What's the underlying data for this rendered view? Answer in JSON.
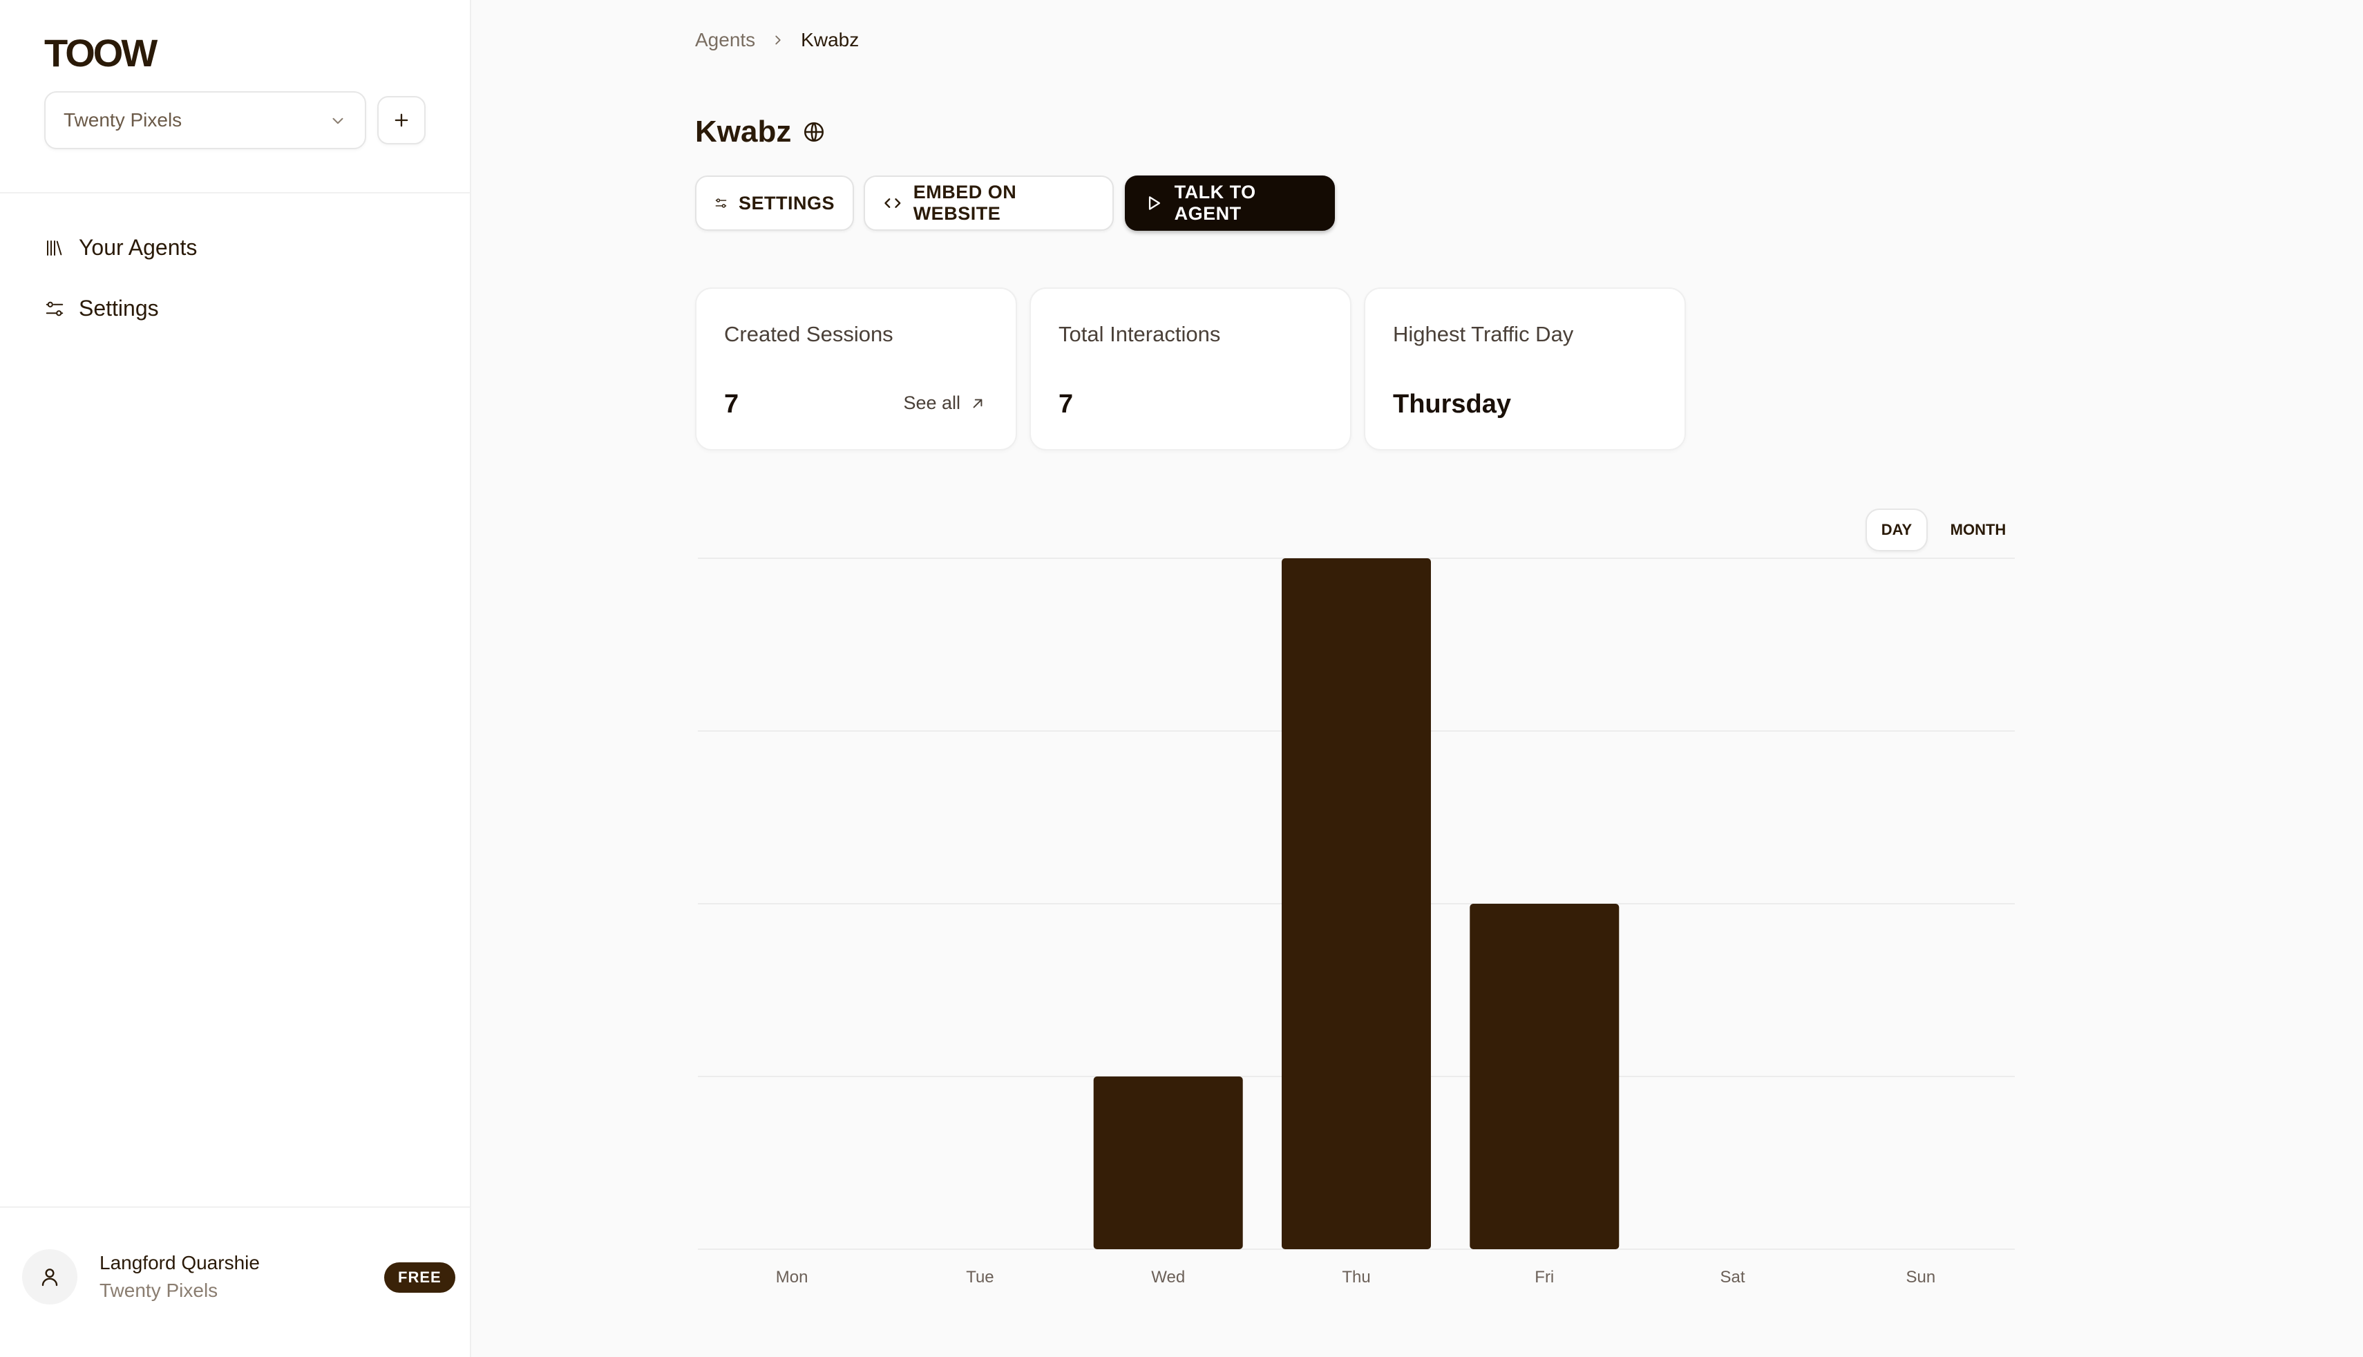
{
  "sidebar": {
    "logo": "TOOW",
    "workspace": {
      "selected": "Twenty Pixels"
    },
    "nav": [
      {
        "label": "Your Agents",
        "icon": "library-icon"
      },
      {
        "label": "Settings",
        "icon": "sliders-icon"
      }
    ],
    "user": {
      "name": "Langford Quarshie",
      "org": "Twenty Pixels",
      "plan": "FREE"
    }
  },
  "breadcrumb": {
    "parent": "Agents",
    "current": "Kwabz"
  },
  "agent": {
    "name": "Kwabz",
    "icon": "globe-icon"
  },
  "actions": {
    "settings": "SETTINGS",
    "embed": "EMBED ON WEBSITE",
    "talk": "TALK TO AGENT"
  },
  "stats": {
    "created_sessions": {
      "label": "Created Sessions",
      "value": "7",
      "link": "See all"
    },
    "total_interactions": {
      "label": "Total Interactions",
      "value": "7"
    },
    "highest_traffic_day": {
      "label": "Highest Traffic Day",
      "value": "Thursday"
    }
  },
  "toggle": {
    "day": "DAY",
    "month": "MONTH",
    "active": "DAY"
  },
  "colors": {
    "accent": "#351e07",
    "badge": "#3a2208",
    "primary_button": "#140b03"
  },
  "chart_data": {
    "type": "bar",
    "categories": [
      "Mon",
      "Tue",
      "Wed",
      "Thu",
      "Fri",
      "Sat",
      "Sun"
    ],
    "values": [
      0,
      0,
      1,
      4,
      2,
      0,
      0
    ],
    "ylim": [
      0,
      4
    ],
    "grid": true,
    "title": "",
    "xlabel": "",
    "ylabel": ""
  }
}
